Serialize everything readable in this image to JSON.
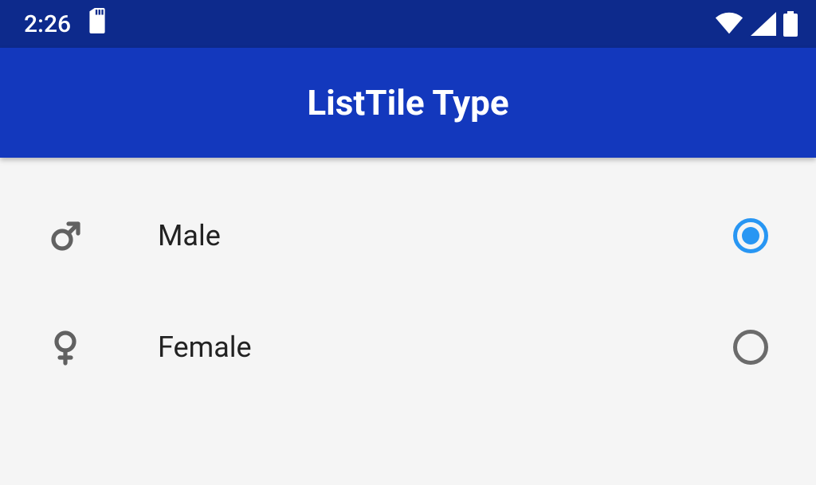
{
  "statusbar": {
    "time": "2:26"
  },
  "appbar": {
    "title": "ListTile Type"
  },
  "options": [
    {
      "icon": "male-icon",
      "label": "Male",
      "selected": true
    },
    {
      "icon": "female-icon",
      "label": "Female",
      "selected": false
    }
  ],
  "colors": {
    "statusbar_bg": "#0d2a8c",
    "appbar_bg": "#1338bd",
    "radio_selected": "#2896f3",
    "radio_unselected": "#6b6b6b"
  }
}
